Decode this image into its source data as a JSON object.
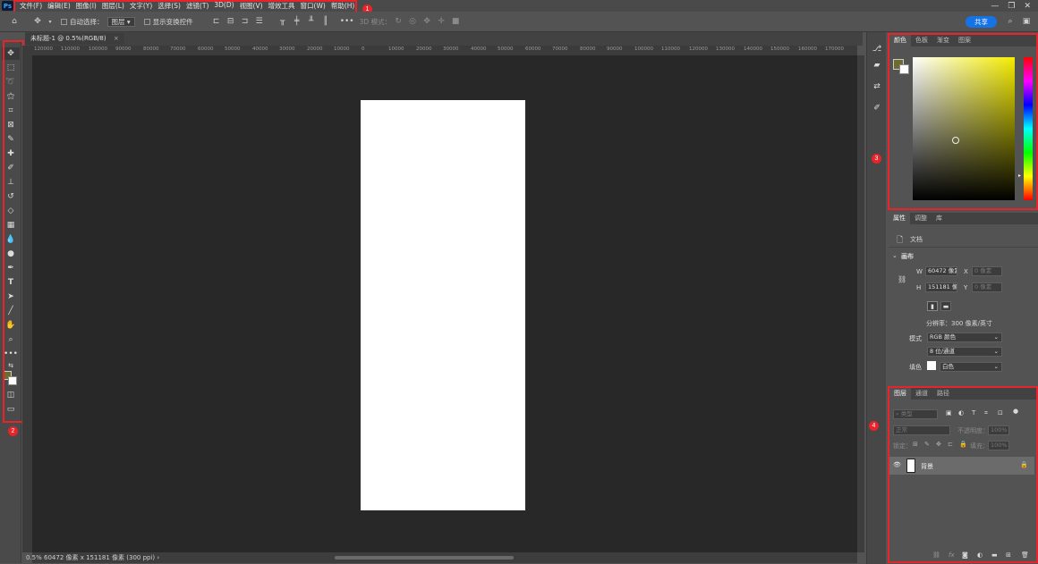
{
  "menubar": {
    "logo": "Ps",
    "items": [
      "文件(F)",
      "编辑(E)",
      "图像(I)",
      "图层(L)",
      "文字(Y)",
      "选择(S)",
      "滤镜(T)",
      "3D(D)",
      "视图(V)",
      "增效工具",
      "窗口(W)",
      "帮助(H)"
    ],
    "win_minimize": "—",
    "win_restore": "❐",
    "win_close": "✕"
  },
  "options": {
    "auto_select_label": "自动选择：",
    "auto_select_value": "图层",
    "show_transform_label": "显示变换控件",
    "mode3d_label": "3D 模式：",
    "share_label": "共享"
  },
  "doc": {
    "tab_title": "未标题-1 @ 0.5%(RGB/8)",
    "tab_close": "×",
    "ruler_ticks": [
      "120000",
      "110000",
      "100000",
      "90000",
      "80000",
      "70000",
      "60000",
      "50000",
      "40000",
      "30000",
      "20000",
      "10000",
      "0",
      "10000",
      "20000",
      "30000",
      "40000",
      "50000",
      "60000",
      "70000",
      "80000",
      "90000",
      "100000",
      "110000",
      "120000",
      "130000",
      "140000",
      "150000",
      "160000",
      "170000"
    ],
    "status_text": "0.5%    60472 像素 x 151181 像素 (300 ppi)   ›"
  },
  "color_panel": {
    "tabs": [
      "颜色",
      "色板",
      "渐变",
      "图案"
    ],
    "fg_color": "#6e6b2e",
    "bg_color": "#ffffff"
  },
  "props_panel": {
    "tabs": [
      "属性",
      "调整",
      "库"
    ],
    "doc_label": "文档",
    "canvas_label": "画布",
    "w_label": "W",
    "w_value": "60472 像素",
    "h_label": "H",
    "h_value": "151181 像",
    "x_label": "X",
    "x_placeholder": "0 像素",
    "y_label": "Y",
    "y_placeholder": "0 像素",
    "resolution": "分辨率：300 像素/英寸",
    "mode_label": "模式",
    "mode_value": "RGB 颜色",
    "depth_value": "8 位/通道",
    "fill_label": "填色",
    "fill_value": "白色"
  },
  "layers_panel": {
    "tabs": [
      "图层",
      "通道",
      "路径"
    ],
    "filter_value": "类型",
    "blend_value": "正常",
    "opacity_label": "不透明度：",
    "opacity_value": "100%",
    "lock_label": "锁定：",
    "fill_label": "填充：",
    "fill_value": "100%",
    "layer_name": "背景"
  },
  "badges": [
    "1",
    "2",
    "3",
    "4"
  ],
  "accent": "#e8232a",
  "share_color": "#1473e6"
}
